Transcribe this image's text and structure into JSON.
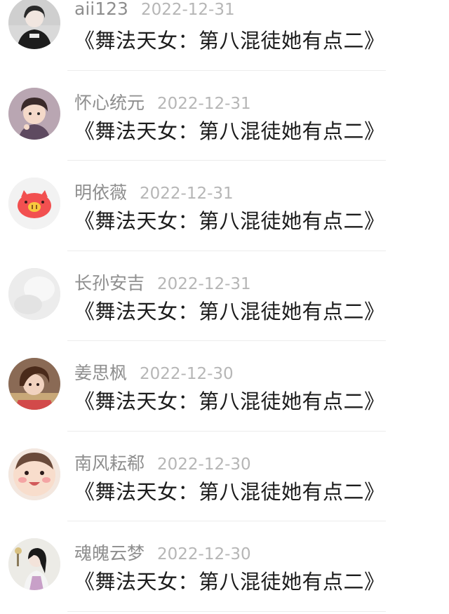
{
  "comments": [
    {
      "username": "aii123",
      "date": "2022-12-31",
      "text": "《舞法天女：第八混徒她有点二》"
    },
    {
      "username": "怀心统元",
      "date": "2022-12-31",
      "text": "《舞法天女：第八混徒她有点二》"
    },
    {
      "username": "明依薇",
      "date": "2022-12-31",
      "text": "《舞法天女：第八混徒她有点二》"
    },
    {
      "username": "长孙安吉",
      "date": "2022-12-31",
      "text": "《舞法天女：第八混徒她有点二》"
    },
    {
      "username": "姜思枫",
      "date": "2022-12-30",
      "text": "《舞法天女：第八混徒她有点二》"
    },
    {
      "username": "南风耘郗",
      "date": "2022-12-30",
      "text": "《舞法天女：第八混徒她有点二》"
    },
    {
      "username": "魂魄云梦",
      "date": "2022-12-30",
      "text": "《舞法天女：第八混徒她有点二》"
    }
  ]
}
